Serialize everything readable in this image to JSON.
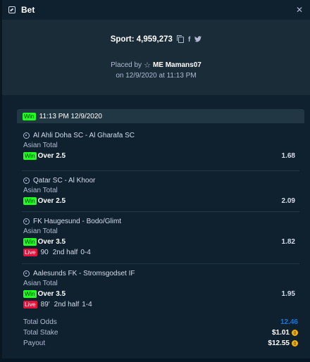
{
  "header": {
    "title": "Bet",
    "close": "✕"
  },
  "sport": {
    "label": "Sport: 4,959,273"
  },
  "placed": {
    "prefix": "Placed by",
    "user": "ME Mamans07",
    "date": "on 12/9/2020 at 11:13 PM"
  },
  "card": {
    "status": "Win",
    "time": "11:13 PM 12/9/2020"
  },
  "legs": [
    {
      "event": "Al Ahli Doha SC - Al Gharafa SC",
      "market": "Asian Total",
      "status": "Win",
      "outcome": "Over 2.5",
      "odds": "1.68"
    },
    {
      "event": "Qatar SC - Al Khoor",
      "market": "Asian Total",
      "status": "Win",
      "outcome": "Over 2.5",
      "odds": "2.09"
    },
    {
      "event": "FK Haugesund - Bodo/Glimt",
      "market": "Asian Total",
      "status": "Win",
      "outcome": "Over 3.5",
      "odds": "1.82",
      "live": {
        "label": "Live",
        "minute": "90",
        "period": "2nd half",
        "score": "0-4"
      }
    },
    {
      "event": "Aalesunds FK - Stromsgodset IF",
      "market": "Asian Total",
      "status": "Win",
      "outcome": "Over 3.5",
      "odds": "1.95",
      "live": {
        "label": "Live",
        "minute": "89'",
        "period": "2nd half",
        "score": "1-4"
      }
    }
  ],
  "totals": {
    "odds_label": "Total Odds",
    "odds_value": "12.46",
    "stake_label": "Total Stake",
    "stake_value": "$1.01",
    "payout_label": "Payout",
    "payout_value": "$12.55"
  },
  "colors": {
    "win": "#1fff20",
    "live": "#e9113c",
    "accent_blue": "#1475e1",
    "coin": "#f0b400"
  },
  "icons": [
    "bet-slip-icon",
    "close-icon",
    "copy-icon",
    "facebook-icon",
    "twitter-icon",
    "vip-star-icon",
    "soccer-ball-icon",
    "coin-icon"
  ]
}
